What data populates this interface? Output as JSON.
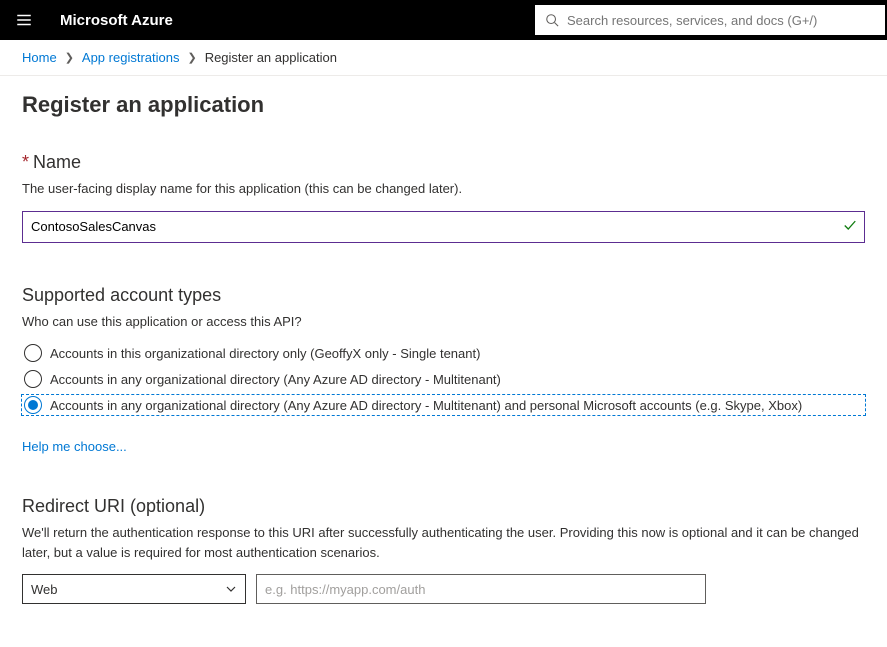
{
  "topbar": {
    "brand": "Microsoft Azure",
    "search_placeholder": "Search resources, services, and docs (G+/)"
  },
  "breadcrumb": {
    "home": "Home",
    "app_reg": "App registrations",
    "current": "Register an application"
  },
  "page_title": "Register an application",
  "name_section": {
    "heading": "Name",
    "desc": "The user-facing display name for this application (this can be changed later).",
    "value": "ContosoSalesCanvas"
  },
  "account_types": {
    "heading": "Supported account types",
    "desc": "Who can use this application or access this API?",
    "options": [
      "Accounts in this organizational directory only (GeoffyX only - Single tenant)",
      "Accounts in any organizational directory (Any Azure AD directory - Multitenant)",
      "Accounts in any organizational directory (Any Azure AD directory - Multitenant) and personal Microsoft accounts (e.g. Skype, Xbox)"
    ],
    "selected_index": 2,
    "help_link": "Help me choose..."
  },
  "redirect": {
    "heading": "Redirect URI (optional)",
    "desc": "We'll return the authentication response to this URI after successfully authenticating the user. Providing this now is optional and it can be changed later, but a value is required for most authentication scenarios.",
    "type_value": "Web",
    "uri_placeholder": "e.g. https://myapp.com/auth"
  }
}
